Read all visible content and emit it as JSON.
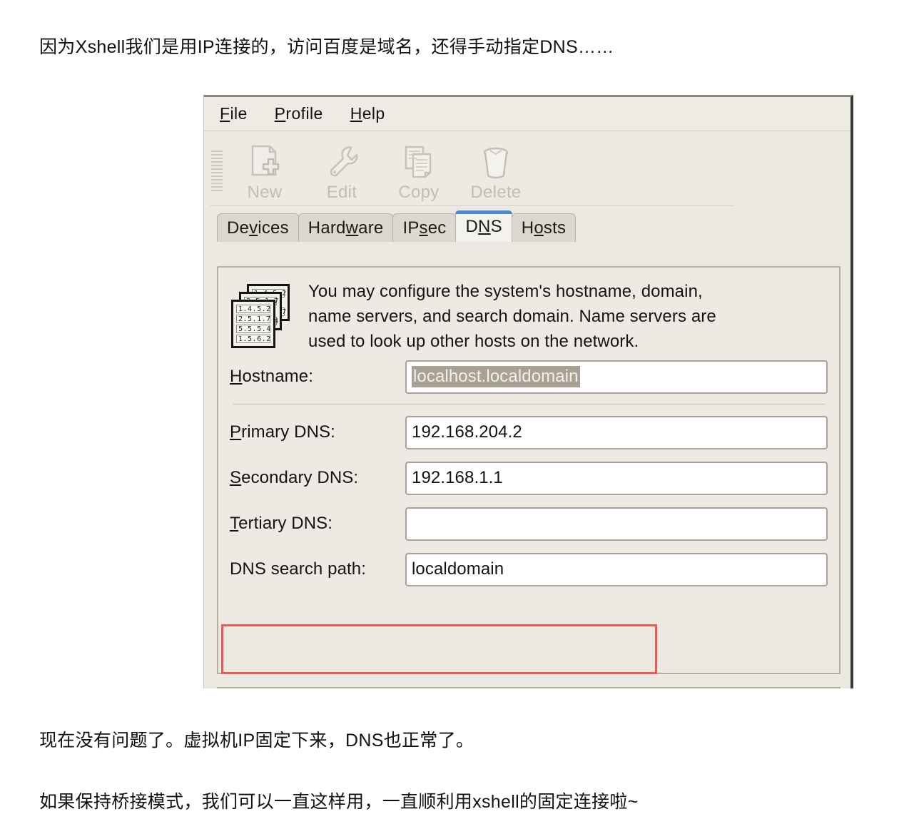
{
  "page": {
    "intro_text": "因为Xshell我们是用IP连接的，访问百度是域名，还得手动指定DNS……",
    "outro_text_1": "现在没有问题了。虚拟机IP固定下来，DNS也正常了。",
    "outro_text_2": "如果保持桥接模式，我们可以一直这样用，一直顺利用xshell的固定连接啦~"
  },
  "window": {
    "menu": [
      {
        "mnemonic": "F",
        "rest": "ile"
      },
      {
        "mnemonic": "P",
        "rest": "rofile"
      },
      {
        "mnemonic": "H",
        "rest": "elp"
      }
    ],
    "toolbar": [
      {
        "label": "New",
        "icon": "new-document-icon",
        "enabled": false
      },
      {
        "label": "Edit",
        "icon": "wrench-icon",
        "enabled": false
      },
      {
        "label": "Copy",
        "icon": "copy-pages-icon",
        "enabled": false
      },
      {
        "label": "Delete",
        "icon": "trash-can-icon",
        "enabled": false
      }
    ],
    "tabs": [
      {
        "pre": "De",
        "mnemonic": "v",
        "post": "ices",
        "active": false
      },
      {
        "pre": "Hard",
        "mnemonic": "w",
        "post": "are",
        "active": false
      },
      {
        "pre": "IP",
        "mnemonic": "s",
        "post": "ec",
        "active": false
      },
      {
        "pre": "D",
        "mnemonic": "N",
        "post": "S",
        "active": true
      },
      {
        "pre": "H",
        "mnemonic": "o",
        "post": "sts",
        "active": false
      }
    ],
    "active_tab_accent": "#4a89d4",
    "panel": {
      "icon_name": "dns-records-stack-icon",
      "icon_card_lines": [
        "1.4.5.2",
        "2.5.1.7",
        "5.5.5.4",
        "1.5.6.2"
      ],
      "description": [
        "You may configure the system's hostname, domain,",
        "name servers, and search domain. Name servers are",
        "used to look up other hosts on the network."
      ],
      "fields": [
        {
          "label_pre": "",
          "label_mnemonic": "H",
          "label_post": "ostname:",
          "value": "localhost.localdomain",
          "selected": true
        },
        {
          "label_pre": "",
          "label_mnemonic": "P",
          "label_post": "rimary DNS:",
          "value": "192.168.204.2",
          "selected": false
        },
        {
          "label_pre": "",
          "label_mnemonic": "S",
          "label_post": "econdary DNS:",
          "value": "192.168.1.1",
          "selected": false
        },
        {
          "label_pre": "",
          "label_mnemonic": "T",
          "label_post": "ertiary DNS:",
          "value": "",
          "selected": false
        },
        {
          "label_pre": "DNS search path:",
          "label_mnemonic": "",
          "label_post": "",
          "value": "localdomain",
          "selected": false
        }
      ]
    },
    "annotation": {
      "name": "secondary-dns-highlight",
      "color": "#ec5a56"
    }
  }
}
